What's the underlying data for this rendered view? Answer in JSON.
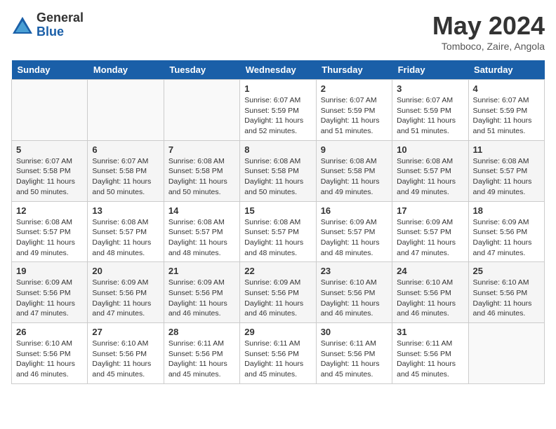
{
  "logo": {
    "general": "General",
    "blue": "Blue"
  },
  "title": "May 2024",
  "location": "Tomboco, Zaire, Angola",
  "days_of_week": [
    "Sunday",
    "Monday",
    "Tuesday",
    "Wednesday",
    "Thursday",
    "Friday",
    "Saturday"
  ],
  "weeks": [
    [
      {
        "num": "",
        "detail": ""
      },
      {
        "num": "",
        "detail": ""
      },
      {
        "num": "",
        "detail": ""
      },
      {
        "num": "1",
        "detail": "Sunrise: 6:07 AM\nSunset: 5:59 PM\nDaylight: 11 hours\nand 52 minutes."
      },
      {
        "num": "2",
        "detail": "Sunrise: 6:07 AM\nSunset: 5:59 PM\nDaylight: 11 hours\nand 51 minutes."
      },
      {
        "num": "3",
        "detail": "Sunrise: 6:07 AM\nSunset: 5:59 PM\nDaylight: 11 hours\nand 51 minutes."
      },
      {
        "num": "4",
        "detail": "Sunrise: 6:07 AM\nSunset: 5:59 PM\nDaylight: 11 hours\nand 51 minutes."
      }
    ],
    [
      {
        "num": "5",
        "detail": "Sunrise: 6:07 AM\nSunset: 5:58 PM\nDaylight: 11 hours\nand 50 minutes."
      },
      {
        "num": "6",
        "detail": "Sunrise: 6:07 AM\nSunset: 5:58 PM\nDaylight: 11 hours\nand 50 minutes."
      },
      {
        "num": "7",
        "detail": "Sunrise: 6:08 AM\nSunset: 5:58 PM\nDaylight: 11 hours\nand 50 minutes."
      },
      {
        "num": "8",
        "detail": "Sunrise: 6:08 AM\nSunset: 5:58 PM\nDaylight: 11 hours\nand 50 minutes."
      },
      {
        "num": "9",
        "detail": "Sunrise: 6:08 AM\nSunset: 5:58 PM\nDaylight: 11 hours\nand 49 minutes."
      },
      {
        "num": "10",
        "detail": "Sunrise: 6:08 AM\nSunset: 5:57 PM\nDaylight: 11 hours\nand 49 minutes."
      },
      {
        "num": "11",
        "detail": "Sunrise: 6:08 AM\nSunset: 5:57 PM\nDaylight: 11 hours\nand 49 minutes."
      }
    ],
    [
      {
        "num": "12",
        "detail": "Sunrise: 6:08 AM\nSunset: 5:57 PM\nDaylight: 11 hours\nand 49 minutes."
      },
      {
        "num": "13",
        "detail": "Sunrise: 6:08 AM\nSunset: 5:57 PM\nDaylight: 11 hours\nand 48 minutes."
      },
      {
        "num": "14",
        "detail": "Sunrise: 6:08 AM\nSunset: 5:57 PM\nDaylight: 11 hours\nand 48 minutes."
      },
      {
        "num": "15",
        "detail": "Sunrise: 6:08 AM\nSunset: 5:57 PM\nDaylight: 11 hours\nand 48 minutes."
      },
      {
        "num": "16",
        "detail": "Sunrise: 6:09 AM\nSunset: 5:57 PM\nDaylight: 11 hours\nand 48 minutes."
      },
      {
        "num": "17",
        "detail": "Sunrise: 6:09 AM\nSunset: 5:57 PM\nDaylight: 11 hours\nand 47 minutes."
      },
      {
        "num": "18",
        "detail": "Sunrise: 6:09 AM\nSunset: 5:56 PM\nDaylight: 11 hours\nand 47 minutes."
      }
    ],
    [
      {
        "num": "19",
        "detail": "Sunrise: 6:09 AM\nSunset: 5:56 PM\nDaylight: 11 hours\nand 47 minutes."
      },
      {
        "num": "20",
        "detail": "Sunrise: 6:09 AM\nSunset: 5:56 PM\nDaylight: 11 hours\nand 47 minutes."
      },
      {
        "num": "21",
        "detail": "Sunrise: 6:09 AM\nSunset: 5:56 PM\nDaylight: 11 hours\nand 46 minutes."
      },
      {
        "num": "22",
        "detail": "Sunrise: 6:09 AM\nSunset: 5:56 PM\nDaylight: 11 hours\nand 46 minutes."
      },
      {
        "num": "23",
        "detail": "Sunrise: 6:10 AM\nSunset: 5:56 PM\nDaylight: 11 hours\nand 46 minutes."
      },
      {
        "num": "24",
        "detail": "Sunrise: 6:10 AM\nSunset: 5:56 PM\nDaylight: 11 hours\nand 46 minutes."
      },
      {
        "num": "25",
        "detail": "Sunrise: 6:10 AM\nSunset: 5:56 PM\nDaylight: 11 hours\nand 46 minutes."
      }
    ],
    [
      {
        "num": "26",
        "detail": "Sunrise: 6:10 AM\nSunset: 5:56 PM\nDaylight: 11 hours\nand 46 minutes."
      },
      {
        "num": "27",
        "detail": "Sunrise: 6:10 AM\nSunset: 5:56 PM\nDaylight: 11 hours\nand 45 minutes."
      },
      {
        "num": "28",
        "detail": "Sunrise: 6:11 AM\nSunset: 5:56 PM\nDaylight: 11 hours\nand 45 minutes."
      },
      {
        "num": "29",
        "detail": "Sunrise: 6:11 AM\nSunset: 5:56 PM\nDaylight: 11 hours\nand 45 minutes."
      },
      {
        "num": "30",
        "detail": "Sunrise: 6:11 AM\nSunset: 5:56 PM\nDaylight: 11 hours\nand 45 minutes."
      },
      {
        "num": "31",
        "detail": "Sunrise: 6:11 AM\nSunset: 5:56 PM\nDaylight: 11 hours\nand 45 minutes."
      },
      {
        "num": "",
        "detail": ""
      }
    ]
  ]
}
